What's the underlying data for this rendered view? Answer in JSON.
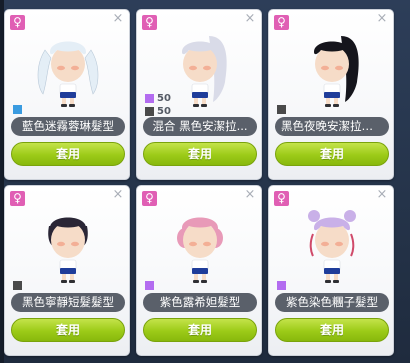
{
  "cards": [
    {
      "gender_icon": "female-icon",
      "gender_symbol": "♀",
      "close_symbol": "×",
      "hair_color": "#e4eef6",
      "hair_style": "twin-tails",
      "stats": [
        {
          "color": "#3a9be0",
          "value": ""
        }
      ],
      "name": "藍色迷霧蓉琳髮型",
      "apply_label": "套用"
    },
    {
      "gender_icon": "female-icon",
      "gender_symbol": "♀",
      "close_symbol": "×",
      "hair_color": "#d9dbe8",
      "hair_style": "ponytail",
      "stats": [
        {
          "color": "#b36cf0",
          "value": "50"
        },
        {
          "color": "#4a4a4a",
          "value": "50"
        }
      ],
      "name": "混合 黑色安潔拉...",
      "apply_label": "套用"
    },
    {
      "gender_icon": "female-icon",
      "gender_symbol": "♀",
      "close_symbol": "×",
      "hair_color": "#15151c",
      "hair_style": "ponytail",
      "stats": [
        {
          "color": "#4a4a4a",
          "value": ""
        }
      ],
      "name": "黑色夜晚安潔拉髮型",
      "apply_label": "套用"
    },
    {
      "gender_icon": "female-icon",
      "gender_symbol": "♀",
      "close_symbol": "×",
      "hair_color": "#2a2636",
      "hair_style": "short",
      "stats": [
        {
          "color": "#4a4a4a",
          "value": ""
        }
      ],
      "name": "黑色寧靜短髮髮型",
      "apply_label": "套用"
    },
    {
      "gender_icon": "female-icon",
      "gender_symbol": "♀",
      "close_symbol": "×",
      "hair_color": "#e89ab8",
      "hair_style": "curly",
      "stats": [
        {
          "color": "#b36cf0",
          "value": ""
        }
      ],
      "name": "紫色露希妲髮型",
      "apply_label": "套用"
    },
    {
      "gender_icon": "female-icon",
      "gender_symbol": "♀",
      "close_symbol": "×",
      "hair_color": "#c9b0e8",
      "hair_style": "buns",
      "stats": [
        {
          "color": "#b36cf0",
          "value": ""
        }
      ],
      "name": "紫色染色糰子髮型",
      "apply_label": "套用"
    }
  ]
}
